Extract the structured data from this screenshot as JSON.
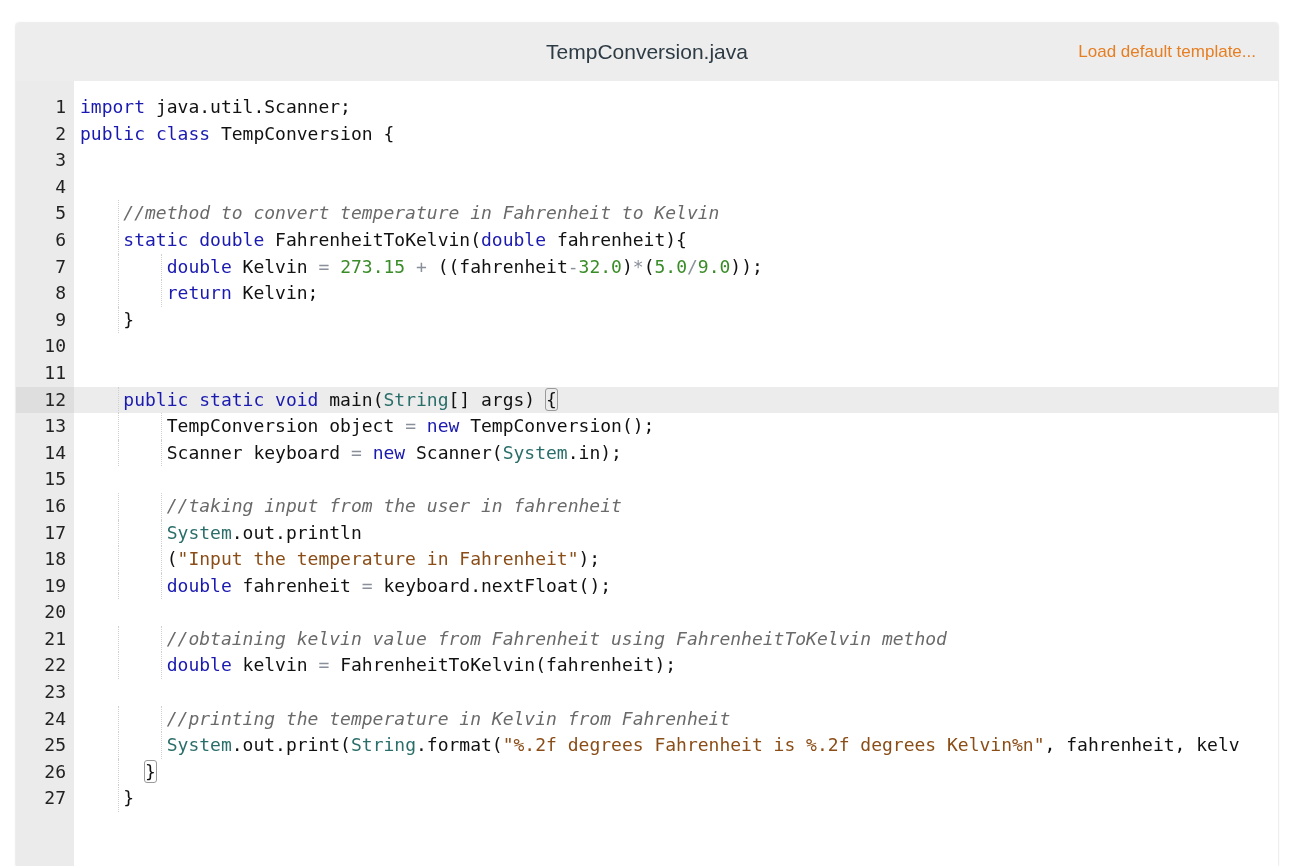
{
  "editor": {
    "filename": "TempConversion.java",
    "template_link": "Load default template...",
    "lines": [
      {
        "number": "1",
        "selected": false,
        "tokens": [
          {
            "kind": "keyword",
            "text": "import"
          },
          {
            "kind": "plain",
            "text": " java.util.Scanner;"
          }
        ]
      },
      {
        "number": "2",
        "selected": false,
        "tokens": [
          {
            "kind": "keyword",
            "text": "public"
          },
          {
            "kind": "keyword",
            "text": " class"
          },
          {
            "kind": "plain",
            "text": " TempConversion {"
          }
        ]
      },
      {
        "number": "3",
        "selected": false
      },
      {
        "number": "4",
        "selected": false
      },
      {
        "number": "5",
        "selected": false,
        "tokens": [
          {
            "kind": "comment",
            "text": "    //method to convert temperature in Fahrenheit to Kelvin"
          }
        ]
      },
      {
        "number": "6",
        "selected": false,
        "tokens": [
          {
            "kind": "keyword",
            "text": "    static double"
          },
          {
            "kind": "plain",
            "text": " FahrenheitToKelvin("
          },
          {
            "kind": "keyword",
            "text": "double"
          },
          {
            "kind": "plain",
            "text": " fahrenheit){"
          }
        ]
      },
      {
        "number": "7",
        "selected": false,
        "tokens": [
          {
            "kind": "keyword",
            "text": "        double"
          },
          {
            "kind": "plain",
            "text": " Kelvin "
          },
          {
            "kind": "operator",
            "text": "="
          },
          {
            "kind": "number",
            "text": " 273.15"
          },
          {
            "kind": "operator",
            "text": " +"
          },
          {
            "kind": "plain",
            "text": " ((fahrenheit"
          },
          {
            "kind": "operator",
            "text": "-"
          },
          {
            "kind": "number",
            "text": "32.0"
          },
          {
            "kind": "plain",
            "text": ")"
          },
          {
            "kind": "operator",
            "text": "*"
          },
          {
            "kind": "plain",
            "text": "("
          },
          {
            "kind": "number",
            "text": "5.0"
          },
          {
            "kind": "operator",
            "text": "/"
          },
          {
            "kind": "number",
            "text": "9.0"
          },
          {
            "kind": "plain",
            "text": "));"
          }
        ]
      },
      {
        "number": "8",
        "selected": false,
        "tokens": [
          {
            "kind": "keyword",
            "text": "        return"
          },
          {
            "kind": "plain",
            "text": " Kelvin;"
          }
        ]
      },
      {
        "number": "9",
        "selected": false,
        "tokens": [
          {
            "kind": "plain",
            "text": "    }"
          }
        ]
      },
      {
        "number": "10",
        "selected": false
      },
      {
        "number": "11",
        "selected": false
      },
      {
        "number": "12",
        "selected": true,
        "tokens": [
          {
            "kind": "keyword",
            "text": "    public static void"
          },
          {
            "kind": "plain",
            "text": " main("
          },
          {
            "kind": "type",
            "text": "String"
          },
          {
            "kind": "plain",
            "text": "[] args) "
          },
          {
            "kind": "bracket",
            "text": "{"
          }
        ]
      },
      {
        "number": "13",
        "selected": false,
        "tokens": [
          {
            "kind": "plain",
            "text": "        TempConversion object "
          },
          {
            "kind": "operator",
            "text": "="
          },
          {
            "kind": "keyword",
            "text": " new"
          },
          {
            "kind": "plain",
            "text": " TempConversion();"
          }
        ]
      },
      {
        "number": "14",
        "selected": false,
        "tokens": [
          {
            "kind": "plain",
            "text": "        Scanner keyboard "
          },
          {
            "kind": "operator",
            "text": "="
          },
          {
            "kind": "keyword",
            "text": " new"
          },
          {
            "kind": "plain",
            "text": " Scanner("
          },
          {
            "kind": "type",
            "text": "System"
          },
          {
            "kind": "plain",
            "text": ".in);"
          }
        ]
      },
      {
        "number": "15",
        "selected": false
      },
      {
        "number": "16",
        "selected": false,
        "tokens": [
          {
            "kind": "comment",
            "text": "        //taking input from the user in fahrenheit"
          }
        ]
      },
      {
        "number": "17",
        "selected": false,
        "tokens": [
          {
            "kind": "type",
            "text": "        System"
          },
          {
            "kind": "plain",
            "text": ".out.println"
          }
        ]
      },
      {
        "number": "18",
        "selected": false,
        "tokens": [
          {
            "kind": "plain",
            "text": "        ("
          },
          {
            "kind": "string",
            "text": "\"Input the temperature in Fahrenheit\""
          },
          {
            "kind": "plain",
            "text": ");"
          }
        ]
      },
      {
        "number": "19",
        "selected": false,
        "tokens": [
          {
            "kind": "keyword",
            "text": "        double"
          },
          {
            "kind": "plain",
            "text": " fahrenheit "
          },
          {
            "kind": "operator",
            "text": "="
          },
          {
            "kind": "plain",
            "text": " keyboard.nextFloat();"
          }
        ]
      },
      {
        "number": "20",
        "selected": false
      },
      {
        "number": "21",
        "selected": false,
        "tokens": [
          {
            "kind": "comment",
            "text": "        //obtaining kelvin value from Fahrenheit using FahrenheitToKelvin method"
          }
        ]
      },
      {
        "number": "22",
        "selected": false,
        "tokens": [
          {
            "kind": "keyword",
            "text": "        double"
          },
          {
            "kind": "plain",
            "text": " kelvin "
          },
          {
            "kind": "operator",
            "text": "="
          },
          {
            "kind": "plain",
            "text": " FahrenheitToKelvin(fahrenheit);"
          }
        ]
      },
      {
        "number": "23",
        "selected": false
      },
      {
        "number": "24",
        "selected": false,
        "tokens": [
          {
            "kind": "comment",
            "text": "        //printing the temperature in Kelvin from Fahrenheit"
          }
        ]
      },
      {
        "number": "25",
        "selected": false,
        "tokens": [
          {
            "kind": "type",
            "text": "        System"
          },
          {
            "kind": "plain",
            "text": ".out.print("
          },
          {
            "kind": "type",
            "text": "String"
          },
          {
            "kind": "plain",
            "text": ".format("
          },
          {
            "kind": "string",
            "text": "\"%.2f degrees Fahrenheit is %.2f degrees Kelvin%n\""
          },
          {
            "kind": "plain",
            "text": ", fahrenheit, kelv"
          }
        ]
      },
      {
        "number": "26",
        "selected": false,
        "tokens": [
          {
            "kind": "bracket",
            "text": "      }"
          }
        ]
      },
      {
        "number": "27",
        "selected": false,
        "tokens": [
          {
            "kind": "plain",
            "text": "    }"
          }
        ]
      }
    ]
  }
}
